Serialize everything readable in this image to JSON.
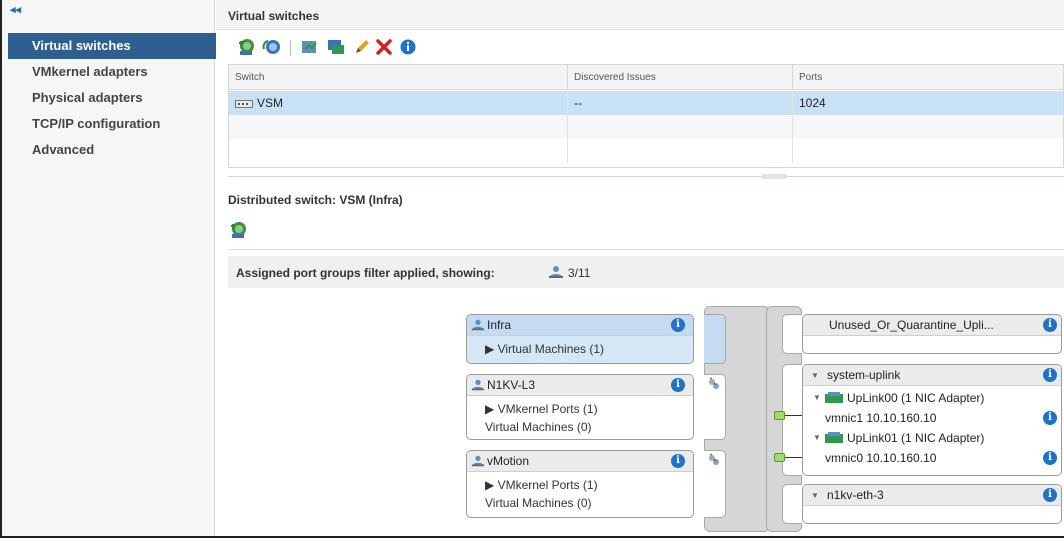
{
  "sidebar": {
    "collapse_glyph": "◂◂",
    "items": [
      {
        "label": "Virtual switches",
        "active": true
      },
      {
        "label": "VMkernel adapters",
        "active": false
      },
      {
        "label": "Physical adapters",
        "active": false
      },
      {
        "label": "TCP/IP configuration",
        "active": false
      },
      {
        "label": "Advanced",
        "active": false
      }
    ]
  },
  "main": {
    "title": "Virtual switches",
    "toolbar_icons": [
      "add-host-networking-icon",
      "refresh-network-icon",
      "migrate-networking-icon",
      "view-settings-icon",
      "edit-icon",
      "remove-icon",
      "info-icon"
    ],
    "table": {
      "columns": [
        "Switch",
        "Discovered Issues",
        "Ports"
      ],
      "rows": [
        {
          "switch": "VSM",
          "issues": "--",
          "ports": "1024",
          "selected": true
        }
      ]
    },
    "detail": {
      "title": "Distributed switch: VSM (Infra)",
      "filter_text": "Assigned port groups filter applied, showing:",
      "filter_count": "3/11"
    },
    "port_groups": [
      {
        "name": "Infra",
        "lines": [
          "▶ Virtual Machines (1)"
        ]
      },
      {
        "name": "N1KV-L3",
        "lines": [
          "▶ VMkernel Ports (1)",
          "Virtual Machines (0)"
        ]
      },
      {
        "name": "vMotion",
        "lines": [
          "▶ VMkernel Ports (1)",
          "Virtual Machines (0)"
        ]
      }
    ],
    "uplinks": {
      "unused": {
        "name": "Unused_Or_Quarantine_Upli..."
      },
      "system": {
        "name": "system-uplink",
        "ports": [
          {
            "name": "UpLink00 (1 NIC Adapter)",
            "nic": "vmnic1 10.10.160.10"
          },
          {
            "name": "UpLink01 (1 NIC Adapter)",
            "nic": "vmnic0 10.10.160.10"
          }
        ]
      },
      "eth3": {
        "name": "n1kv-eth-3"
      }
    },
    "colors": {
      "accent": "#2f5f91",
      "selection": "#c9e1f5",
      "info": "#1f72c8"
    }
  }
}
